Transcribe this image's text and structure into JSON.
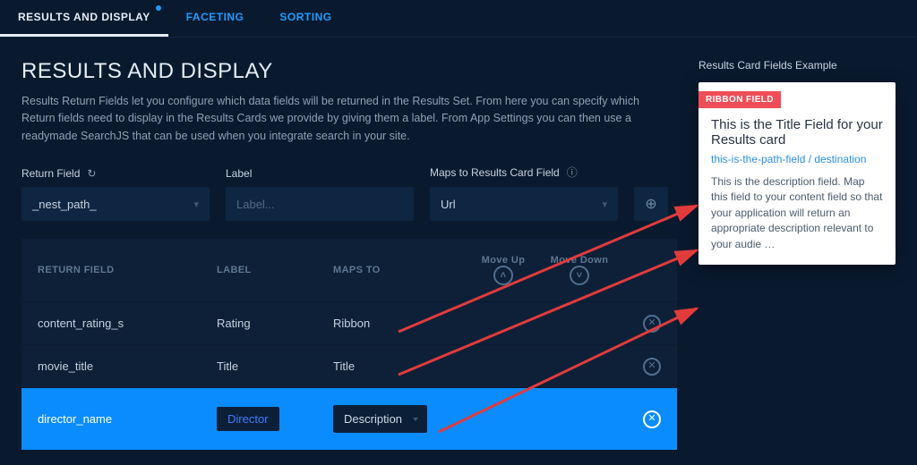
{
  "tabs": {
    "results": "RESULTS AND DISPLAY",
    "faceting": "FACETING",
    "sorting": "SORTING"
  },
  "heading": "RESULTS AND DISPLAY",
  "blurb": "Results Return Fields let you configure which data fields will be returned in the Results Set. From here you can specify which Return fields need to display in the Results Cards we provide by giving them a label. From App Settings you can then use a readymade SearchJS that can be used when you integrate search in your site.",
  "form": {
    "returnFieldLabel": "Return Field",
    "returnFieldValue": "_nest_path_",
    "labelLabel": "Label",
    "labelPlaceholder": "Label...",
    "mapsLabel": "Maps to Results Card Field",
    "mapsValue": "Url"
  },
  "table": {
    "headers": {
      "returnField": "RETURN FIELD",
      "label": "LABEL",
      "mapsTo": "MAPS TO",
      "moveUp": "Move Up",
      "moveDown": "Move Down"
    },
    "rows": [
      {
        "field": "content_rating_s",
        "label": "Rating",
        "maps": "Ribbon"
      },
      {
        "field": "movie_title",
        "label": "Title",
        "maps": "Title"
      },
      {
        "field": "director_name",
        "label": "Director",
        "maps": "Description"
      }
    ]
  },
  "example": {
    "heading": "Results Card Fields Example",
    "ribbon": "RIBBON FIELD",
    "title": "This is the Title Field for your Results card",
    "path": "this-is-the-path-field / destination",
    "desc": "This is the description field. Map this field to your content field so that your application will return an appropriate description relevant to your audie …"
  }
}
